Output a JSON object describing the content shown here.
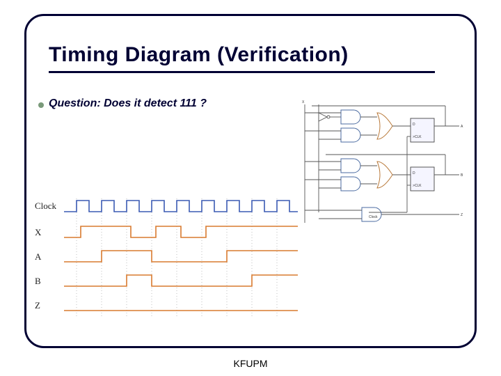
{
  "slide": {
    "title": "Timing Diagram (Verification)",
    "question": "Question:  Does it detect 111 ?",
    "footer": "KFUPM"
  },
  "timing": {
    "signals": [
      "Clock",
      "X",
      "A",
      "B",
      "Z"
    ],
    "clock_periods": 9
  },
  "circuit": {
    "inputs": [
      "X",
      "Clock"
    ],
    "flipflops": [
      {
        "label_d": "D",
        "label_clk": ">CLK"
      },
      {
        "label_d": "D",
        "label_clk": ">CLK"
      }
    ],
    "outputs": [
      "A",
      "B",
      "Z"
    ]
  },
  "chart_data": {
    "type": "timing",
    "clock": {
      "periods": 9,
      "duty": 0.5
    },
    "signals": [
      {
        "name": "X",
        "values_per_period": [
          0,
          1,
          1,
          0,
          1,
          0,
          1,
          1,
          1
        ]
      },
      {
        "name": "A",
        "values_per_period": [
          0,
          0,
          1,
          1,
          0,
          0,
          0,
          1,
          1
        ]
      },
      {
        "name": "B",
        "values_per_period": [
          0,
          0,
          0,
          1,
          0,
          0,
          0,
          0,
          1
        ]
      },
      {
        "name": "Z",
        "values_per_period": [
          0,
          0,
          0,
          0,
          0,
          0,
          0,
          0,
          0
        ]
      }
    ],
    "title": "Timing Diagram (Verification)"
  }
}
